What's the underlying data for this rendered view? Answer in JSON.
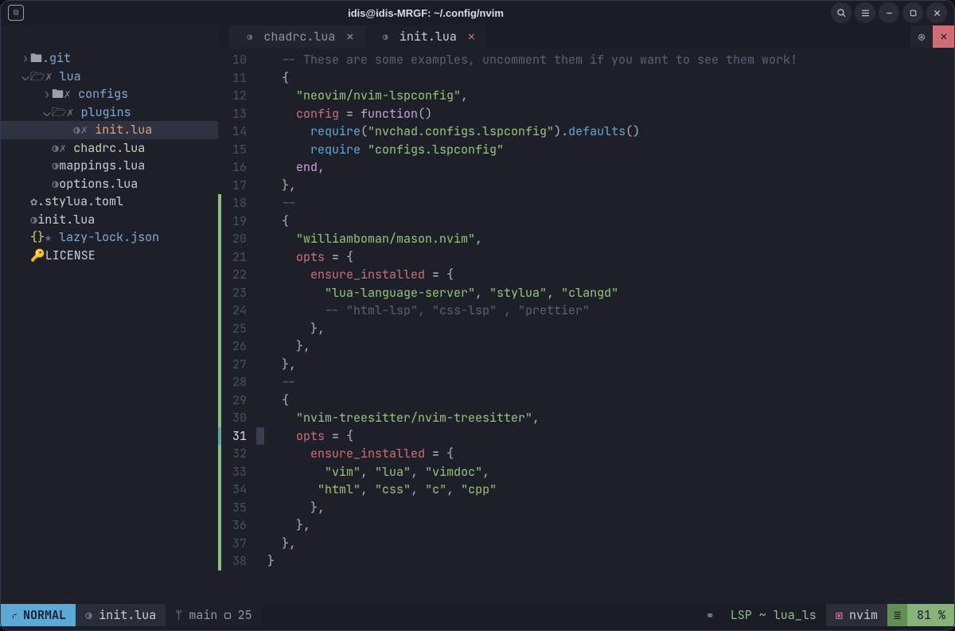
{
  "window": {
    "title": "idis@idis-MRGF: ~/.config/nvim"
  },
  "titlebar_icons": {
    "app": "⌘",
    "search": "search-icon",
    "menu": "menu-icon",
    "minimize": "minimize-icon",
    "maximize": "maximize-icon",
    "close": "close-icon"
  },
  "tree": [
    {
      "depth": 0,
      "chev": "›",
      "ico": "folder",
      "name": ".git",
      "cls": "name-folder"
    },
    {
      "depth": 0,
      "chev": "⌄",
      "ico": "folder-open",
      "pre": "✗",
      "name": "lua",
      "cls": "name-special"
    },
    {
      "depth": 1,
      "chev": "›",
      "ico": "folder",
      "pre": "✗",
      "name": "configs",
      "cls": "name-special"
    },
    {
      "depth": 1,
      "chev": "⌄",
      "ico": "folder-open",
      "pre": "✗",
      "name": "plugins",
      "cls": "name-special"
    },
    {
      "depth": 2,
      "chev": " ",
      "ico": "lua-dot",
      "pre": "✗",
      "name": "init.lua",
      "cls": "name-active",
      "sel": true
    },
    {
      "depth": 1,
      "chev": " ",
      "ico": "lua-dot",
      "pre": "✗",
      "name": "chadrc.lua",
      "cls": "name-chadrc"
    },
    {
      "depth": 1,
      "chev": " ",
      "ico": "lua-dot",
      "name": "mappings.lua",
      "cls": "name-file"
    },
    {
      "depth": 1,
      "chev": " ",
      "ico": "lua-dot",
      "name": "options.lua",
      "cls": "name-file"
    },
    {
      "depth": 0,
      "chev": " ",
      "ico": "gear",
      "name": ".stylua.toml",
      "cls": "name-file"
    },
    {
      "depth": 0,
      "chev": " ",
      "ico": "lua-dot",
      "name": "init.lua",
      "cls": "name-file"
    },
    {
      "depth": 0,
      "chev": " ",
      "ico": "json",
      "pre": "★",
      "name": "lazy-lock.json",
      "cls": "name-special"
    },
    {
      "depth": 0,
      "chev": " ",
      "ico": "key",
      "name": "LICENSE",
      "cls": "name-file"
    }
  ],
  "tabs": [
    {
      "label": "chadrc.lua",
      "active": false
    },
    {
      "label": "init.lua",
      "active": true
    }
  ],
  "code": {
    "first_line": 10,
    "current_line": 31,
    "lines": [
      {
        "n": 10,
        "bar": "",
        "tokens": [
          [
            "c-comment",
            "  -- These are some examples, uncomment them if you want to see them work!"
          ]
        ]
      },
      {
        "n": 11,
        "bar": "",
        "tokens": [
          [
            "c-punc",
            "  {"
          ]
        ]
      },
      {
        "n": 12,
        "bar": "",
        "tokens": [
          [
            "c-punc",
            "    "
          ],
          [
            "c-str",
            "\"neovim/nvim-lspconfig\""
          ],
          [
            "c-punc",
            ","
          ]
        ]
      },
      {
        "n": 13,
        "bar": "",
        "tokens": [
          [
            "c-punc",
            "    "
          ],
          [
            "c-field",
            "config"
          ],
          [
            "c-op",
            " = "
          ],
          [
            "c-key",
            "function"
          ],
          [
            "c-punc",
            "()"
          ]
        ]
      },
      {
        "n": 14,
        "bar": "",
        "tokens": [
          [
            "c-punc",
            "      "
          ],
          [
            "c-func",
            "require"
          ],
          [
            "c-punc",
            "("
          ],
          [
            "c-str",
            "\"nvchad.configs.lspconfig\""
          ],
          [
            "c-punc",
            ")."
          ],
          [
            "c-method",
            "defaults"
          ],
          [
            "c-punc",
            "()"
          ]
        ]
      },
      {
        "n": 15,
        "bar": "",
        "tokens": [
          [
            "c-punc",
            "      "
          ],
          [
            "c-func",
            "require"
          ],
          [
            "c-punc",
            " "
          ],
          [
            "c-str",
            "\"configs.lspconfig\""
          ]
        ]
      },
      {
        "n": 16,
        "bar": "",
        "tokens": [
          [
            "c-punc",
            "    "
          ],
          [
            "c-key",
            "end"
          ],
          [
            "c-punc",
            ","
          ]
        ]
      },
      {
        "n": 17,
        "bar": "",
        "tokens": [
          [
            "c-punc",
            "  },"
          ]
        ]
      },
      {
        "n": 18,
        "bar": "g",
        "tokens": [
          [
            "c-comment",
            "  --"
          ]
        ]
      },
      {
        "n": 19,
        "bar": "g",
        "tokens": [
          [
            "c-punc",
            "  {"
          ]
        ]
      },
      {
        "n": 20,
        "bar": "g",
        "tokens": [
          [
            "c-punc",
            "    "
          ],
          [
            "c-str",
            "\"williamboman/mason.nvim\""
          ],
          [
            "c-punc",
            ","
          ]
        ]
      },
      {
        "n": 21,
        "bar": "g",
        "tokens": [
          [
            "c-punc",
            "    "
          ],
          [
            "c-field",
            "opts"
          ],
          [
            "c-op",
            " = "
          ],
          [
            "c-punc",
            "{"
          ]
        ]
      },
      {
        "n": 22,
        "bar": "g",
        "tokens": [
          [
            "c-punc",
            "      "
          ],
          [
            "c-field",
            "ensure_installed"
          ],
          [
            "c-op",
            " = "
          ],
          [
            "c-punc",
            "{"
          ]
        ]
      },
      {
        "n": 23,
        "bar": "g",
        "tokens": [
          [
            "c-punc",
            "        "
          ],
          [
            "c-str",
            "\"lua-language-server\""
          ],
          [
            "c-punc",
            ", "
          ],
          [
            "c-str",
            "\"stylua\""
          ],
          [
            "c-punc",
            ", "
          ],
          [
            "c-str",
            "\"clangd\""
          ]
        ]
      },
      {
        "n": 24,
        "bar": "g",
        "tokens": [
          [
            "c-comment",
            "        -- \"html-lsp\", \"css-lsp\" , \"prettier\""
          ]
        ]
      },
      {
        "n": 25,
        "bar": "g",
        "tokens": [
          [
            "c-punc",
            "      },"
          ]
        ]
      },
      {
        "n": 26,
        "bar": "g",
        "tokens": [
          [
            "c-punc",
            "    },"
          ]
        ]
      },
      {
        "n": 27,
        "bar": "g",
        "tokens": [
          [
            "c-punc",
            "  },"
          ]
        ]
      },
      {
        "n": 28,
        "bar": "g",
        "tokens": [
          [
            "c-comment",
            "  --"
          ]
        ]
      },
      {
        "n": 29,
        "bar": "g",
        "tokens": [
          [
            "c-punc",
            "  {"
          ]
        ]
      },
      {
        "n": 30,
        "bar": "g",
        "tokens": [
          [
            "c-punc",
            "    "
          ],
          [
            "c-str",
            "\"nvim-treesitter/nvim-treesitter\""
          ],
          [
            "c-punc",
            ","
          ]
        ]
      },
      {
        "n": 31,
        "bar": "t",
        "tokens": [
          [
            "c-punc",
            "    "
          ],
          [
            "c-field",
            "opts"
          ],
          [
            "c-op",
            " = "
          ],
          [
            "c-punc",
            "{"
          ]
        ]
      },
      {
        "n": 32,
        "bar": "g",
        "tokens": [
          [
            "c-punc",
            "      "
          ],
          [
            "c-field",
            "ensure_installed"
          ],
          [
            "c-op",
            " = "
          ],
          [
            "c-punc",
            "{"
          ]
        ]
      },
      {
        "n": 33,
        "bar": "g",
        "tokens": [
          [
            "c-punc",
            "        "
          ],
          [
            "c-str",
            "\"vim\""
          ],
          [
            "c-punc",
            ", "
          ],
          [
            "c-str",
            "\"lua\""
          ],
          [
            "c-punc",
            ", "
          ],
          [
            "c-str",
            "\"vimdoc\""
          ],
          [
            "c-punc",
            ","
          ]
        ]
      },
      {
        "n": 34,
        "bar": "g",
        "tokens": [
          [
            "c-punc",
            "       "
          ],
          [
            "c-str",
            "\"html\""
          ],
          [
            "c-punc",
            ", "
          ],
          [
            "c-str",
            "\"css\""
          ],
          [
            "c-punc",
            ", "
          ],
          [
            "c-str",
            "\"c\""
          ],
          [
            "c-punc",
            ", "
          ],
          [
            "c-str",
            "\"cpp\""
          ]
        ]
      },
      {
        "n": 35,
        "bar": "g",
        "tokens": [
          [
            "c-punc",
            "      },"
          ]
        ]
      },
      {
        "n": 36,
        "bar": "g",
        "tokens": [
          [
            "c-punc",
            "    },"
          ]
        ]
      },
      {
        "n": 37,
        "bar": "g",
        "tokens": [
          [
            "c-punc",
            "  },"
          ]
        ]
      },
      {
        "n": 38,
        "bar": "g",
        "tokens": [
          [
            "c-punc",
            "}"
          ]
        ]
      }
    ]
  },
  "status": {
    "mode": "NORMAL",
    "file": "init.lua",
    "branch": "main",
    "branch_extra": "25",
    "lsp": "LSP ~ lua_ls",
    "folder": "nvim",
    "percent": "81 %"
  }
}
